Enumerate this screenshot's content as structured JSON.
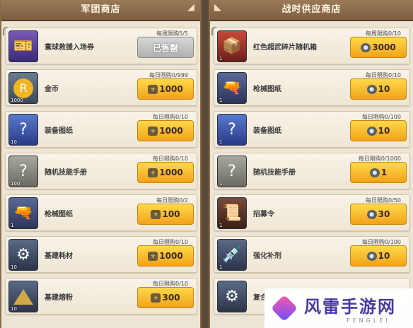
{
  "left_shop": {
    "title": "军团商店",
    "items": [
      {
        "name": "寰球救援入场券",
        "limit": "每周限购5/5",
        "price": "已售罄",
        "currency": "",
        "qty": "",
        "icon": "ticket-icon",
        "sold_out": true
      },
      {
        "name": "金币",
        "limit": "每日限购0/999",
        "price": "1000",
        "currency": "legion-coin-icon",
        "qty": "1000",
        "icon": "gold-coin-icon",
        "sold_out": false
      },
      {
        "name": "装备图纸",
        "limit": "每日限购0/10",
        "price": "1000",
        "currency": "legion-coin-icon",
        "qty": "10",
        "icon": "equipment-blueprint-icon",
        "sold_out": false
      },
      {
        "name": "随机技能手册",
        "limit": "每日限购0/10",
        "price": "1000",
        "currency": "legion-coin-icon",
        "qty": "100",
        "icon": "skill-manual-icon",
        "sold_out": false
      },
      {
        "name": "枪械图纸",
        "limit": "每日限购0/2",
        "price": "100",
        "currency": "legion-coin-icon",
        "qty": "1",
        "icon": "gun-blueprint-icon",
        "sold_out": false
      },
      {
        "name": "基建耗材",
        "limit": "每日限购0/10",
        "price": "1000",
        "currency": "legion-coin-icon",
        "qty": "10",
        "icon": "building-material-icon",
        "sold_out": false
      },
      {
        "name": "基建熔粉",
        "limit": "每日限购0/10",
        "price": "300",
        "currency": "legion-coin-icon",
        "qty": "10",
        "icon": "melt-powder-icon",
        "sold_out": false
      }
    ]
  },
  "right_shop": {
    "title": "战时供应商店",
    "items": [
      {
        "name": "红色超武碎片随机箱",
        "limit": "每周限购0/10",
        "price": "3000",
        "currency": "steel-coin-icon",
        "qty": "1",
        "icon": "red-crate-icon"
      },
      {
        "name": "枪械图纸",
        "limit": "每日限购0/10",
        "price": "10",
        "currency": "steel-coin-icon",
        "qty": "1",
        "icon": "gun-blueprint-icon"
      },
      {
        "name": "装备图纸",
        "limit": "每日限购0/100",
        "price": "10",
        "currency": "steel-coin-icon",
        "qty": "1",
        "icon": "equipment-blueprint-icon"
      },
      {
        "name": "随机技能手册",
        "limit": "每日限购0/1000",
        "price": "1",
        "currency": "steel-coin-icon",
        "qty": "1",
        "icon": "skill-manual-icon"
      },
      {
        "name": "招募令",
        "limit": "每日限购0/50",
        "price": "30",
        "currency": "steel-coin-icon",
        "qty": "1",
        "icon": "recruit-order-icon"
      },
      {
        "name": "强化补剂",
        "limit": "每日限购0/100",
        "price": "10",
        "currency": "steel-coin-icon",
        "qty": "1",
        "icon": "syringe-icon"
      },
      {
        "name": "复合",
        "limit": "",
        "price": "",
        "currency": "",
        "qty": "",
        "icon": "composite-item-icon"
      }
    ]
  },
  "watermark": {
    "cn": "风雷手游网",
    "en": "FENGLEI"
  }
}
